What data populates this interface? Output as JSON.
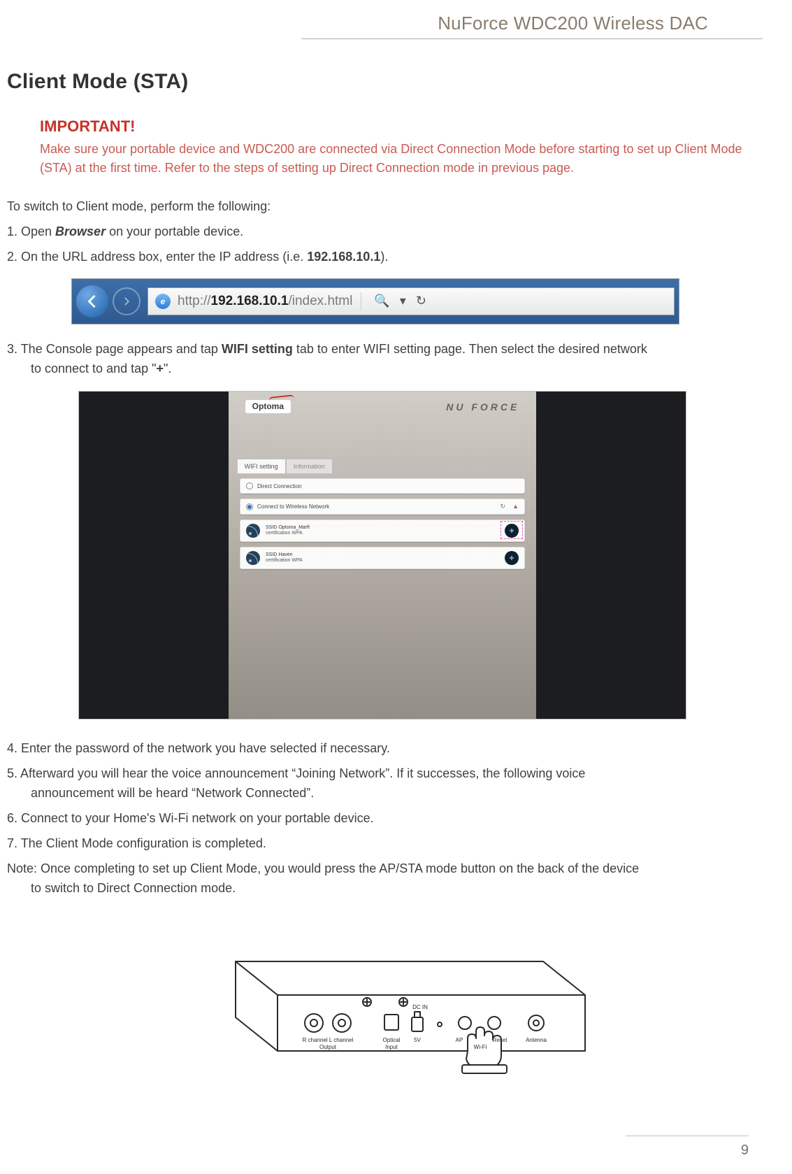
{
  "header": {
    "title": "NuForce WDC200 Wireless DAC"
  },
  "section_title": "Client Mode (STA)",
  "important": {
    "title": "IMPORTANT!",
    "body": "Make sure your portable device and WDC200 are connected via Direct Connection Mode before starting to set up Client Mode (STA) at the first time. Refer to the steps of setting up Direct Connection mode in previous page."
  },
  "lead": "To switch to Client mode, perform the following:",
  "step1": {
    "pre": "1. Open ",
    "bold": "Browser",
    "post": " on your portable device."
  },
  "step2": {
    "pre": "2. On the URL address box, enter the IP address (i.e. ",
    "ip": "192.168.10.1",
    "post": ")."
  },
  "addrbar": {
    "prefix": "http://",
    "ip": "192.168.10.1",
    "suffix": "/index.html"
  },
  "step3": {
    "pre": "3. The Console page appears and tap ",
    "bold": "WIFI setting",
    "mid": " tab to enter WIFI setting page. Then select the desired network",
    "indent_pre": "to connect to and tap \"",
    "plus": "+",
    "indent_post": "\"."
  },
  "console": {
    "brand": "Optoma",
    "brand2": "NU FORCE",
    "tabs": {
      "active": "WIFI setting",
      "inactive": "Information"
    },
    "row_direct": "Direct Connection",
    "row_connect": "Connect to Wireless Network",
    "networks": [
      {
        "ssid_label": "SSID",
        "ssid": "Optoma_Marft",
        "cert_label": "certification",
        "cert": "WPA"
      },
      {
        "ssid_label": "SSID",
        "ssid": "Haven",
        "cert_label": "certification",
        "cert": "WPA"
      }
    ]
  },
  "step4": "4. Enter the password of the network you have selected if necessary.",
  "step5": {
    "line1": "5. Afterward you will hear the voice announcement “Joining Network”. If it successes, the following voice",
    "line2": "announcement will be heard “Network Connected”."
  },
  "step6": "6. Connect to your Home's Wi-Fi network on your portable device.",
  "step7": "7. The Client Mode configuration is completed.",
  "note": {
    "line1": "Note: Once completing to set up Client Mode, you would press the AP/STA mode button on the back of the device",
    "line2": "to switch to Direct Connection mode."
  },
  "device_labels": {
    "rca": "R channel   L channel",
    "rca2": "Output",
    "opt": "Optical",
    "opt2": "Input",
    "dc": "DC IN",
    "v5": "5V",
    "ap": "AP",
    "wifi": "Wi-Fi",
    "reset": "Reset",
    "ant": "Antenna"
  },
  "page_number": "9"
}
